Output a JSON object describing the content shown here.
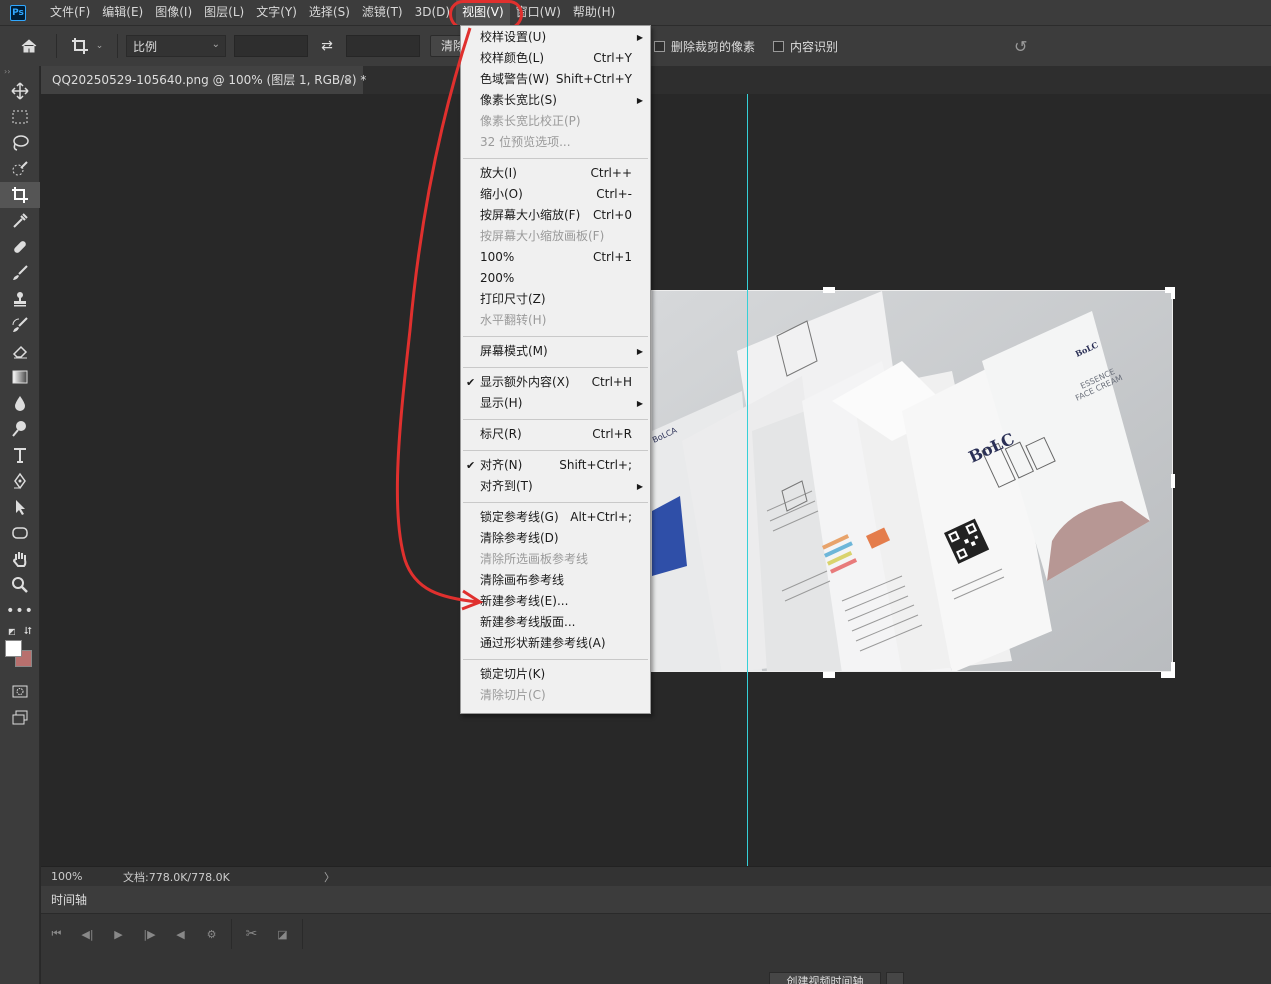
{
  "app": {
    "logo": "Ps"
  },
  "menubar": {
    "items": [
      "文件(F)",
      "编辑(E)",
      "图像(I)",
      "图层(L)",
      "文字(Y)",
      "选择(S)",
      "滤镜(T)",
      "3D(D)",
      "视图(V)",
      "窗口(W)",
      "帮助(H)"
    ],
    "open_index": 8
  },
  "options": {
    "ratio_select": "比例",
    "clear_label": "清除",
    "delete_cropped_label": "删除裁剪的像素",
    "content_aware_label": "内容识别"
  },
  "document": {
    "tab_title": "QQ20250529-105640.png @ 100% (图层 1, RGB/8) *",
    "close_glyph": "×"
  },
  "view_menu": {
    "groups": [
      [
        {
          "label": "校样设置(U)",
          "shortcut": "",
          "submenu": true,
          "disabled": false,
          "checked": false
        },
        {
          "label": "校样颜色(L)",
          "shortcut": "Ctrl+Y",
          "submenu": false,
          "disabled": false,
          "checked": false
        },
        {
          "label": "色域警告(W)",
          "shortcut": "Shift+Ctrl+Y",
          "submenu": false,
          "disabled": false,
          "checked": false
        },
        {
          "label": "像素长宽比(S)",
          "shortcut": "",
          "submenu": true,
          "disabled": false,
          "checked": false
        },
        {
          "label": "像素长宽比校正(P)",
          "shortcut": "",
          "submenu": false,
          "disabled": true,
          "checked": false
        },
        {
          "label": "32 位预览选项...",
          "shortcut": "",
          "submenu": false,
          "disabled": true,
          "checked": false
        }
      ],
      [
        {
          "label": "放大(I)",
          "shortcut": "Ctrl++",
          "submenu": false,
          "disabled": false,
          "checked": false
        },
        {
          "label": "缩小(O)",
          "shortcut": "Ctrl+-",
          "submenu": false,
          "disabled": false,
          "checked": false
        },
        {
          "label": "按屏幕大小缩放(F)",
          "shortcut": "Ctrl+0",
          "submenu": false,
          "disabled": false,
          "checked": false
        },
        {
          "label": "按屏幕大小缩放画板(F)",
          "shortcut": "",
          "submenu": false,
          "disabled": true,
          "checked": false
        },
        {
          "label": "100%",
          "shortcut": "Ctrl+1",
          "submenu": false,
          "disabled": false,
          "checked": false
        },
        {
          "label": "200%",
          "shortcut": "",
          "submenu": false,
          "disabled": false,
          "checked": false
        },
        {
          "label": "打印尺寸(Z)",
          "shortcut": "",
          "submenu": false,
          "disabled": false,
          "checked": false
        },
        {
          "label": "水平翻转(H)",
          "shortcut": "",
          "submenu": false,
          "disabled": true,
          "checked": false
        }
      ],
      [
        {
          "label": "屏幕模式(M)",
          "shortcut": "",
          "submenu": true,
          "disabled": false,
          "checked": false
        }
      ],
      [
        {
          "label": "显示额外内容(X)",
          "shortcut": "Ctrl+H",
          "submenu": false,
          "disabled": false,
          "checked": true
        },
        {
          "label": "显示(H)",
          "shortcut": "",
          "submenu": true,
          "disabled": false,
          "checked": false
        }
      ],
      [
        {
          "label": "标尺(R)",
          "shortcut": "Ctrl+R",
          "submenu": false,
          "disabled": false,
          "checked": false
        }
      ],
      [
        {
          "label": "对齐(N)",
          "shortcut": "Shift+Ctrl+;",
          "submenu": false,
          "disabled": false,
          "checked": true
        },
        {
          "label": "对齐到(T)",
          "shortcut": "",
          "submenu": true,
          "disabled": false,
          "checked": false
        }
      ],
      [
        {
          "label": "锁定参考线(G)",
          "shortcut": "Alt+Ctrl+;",
          "submenu": false,
          "disabled": false,
          "checked": false
        },
        {
          "label": "清除参考线(D)",
          "shortcut": "",
          "submenu": false,
          "disabled": false,
          "checked": false
        },
        {
          "label": "清除所选画板参考线",
          "shortcut": "",
          "submenu": false,
          "disabled": true,
          "checked": false
        },
        {
          "label": "清除画布参考线",
          "shortcut": "",
          "submenu": false,
          "disabled": false,
          "checked": false
        },
        {
          "label": "新建参考线(E)...",
          "shortcut": "",
          "submenu": false,
          "disabled": false,
          "checked": false
        },
        {
          "label": "新建参考线版面...",
          "shortcut": "",
          "submenu": false,
          "disabled": false,
          "checked": false
        },
        {
          "label": "通过形状新建参考线(A)",
          "shortcut": "",
          "submenu": false,
          "disabled": false,
          "checked": false
        }
      ],
      [
        {
          "label": "锁定切片(K)",
          "shortcut": "",
          "submenu": false,
          "disabled": false,
          "checked": false
        },
        {
          "label": "清除切片(C)",
          "shortcut": "",
          "submenu": false,
          "disabled": true,
          "checked": false
        }
      ]
    ]
  },
  "brochure": {
    "brand": "BoLC",
    "product_line1": "ESSENCE",
    "product_line2": "FACE CREAM",
    "side_brand": "BoLCA"
  },
  "status": {
    "zoom": "100%",
    "doc_size": "文档:778.0K/778.0K",
    "arrow": "〉"
  },
  "timeline": {
    "tab_label": "时间轴",
    "create_button": "创建视频时间轴"
  },
  "colors": {
    "annotation": "#e0302e",
    "guide": "#35d0d8",
    "foreground": "#ffffff",
    "background": "#b8706e"
  }
}
